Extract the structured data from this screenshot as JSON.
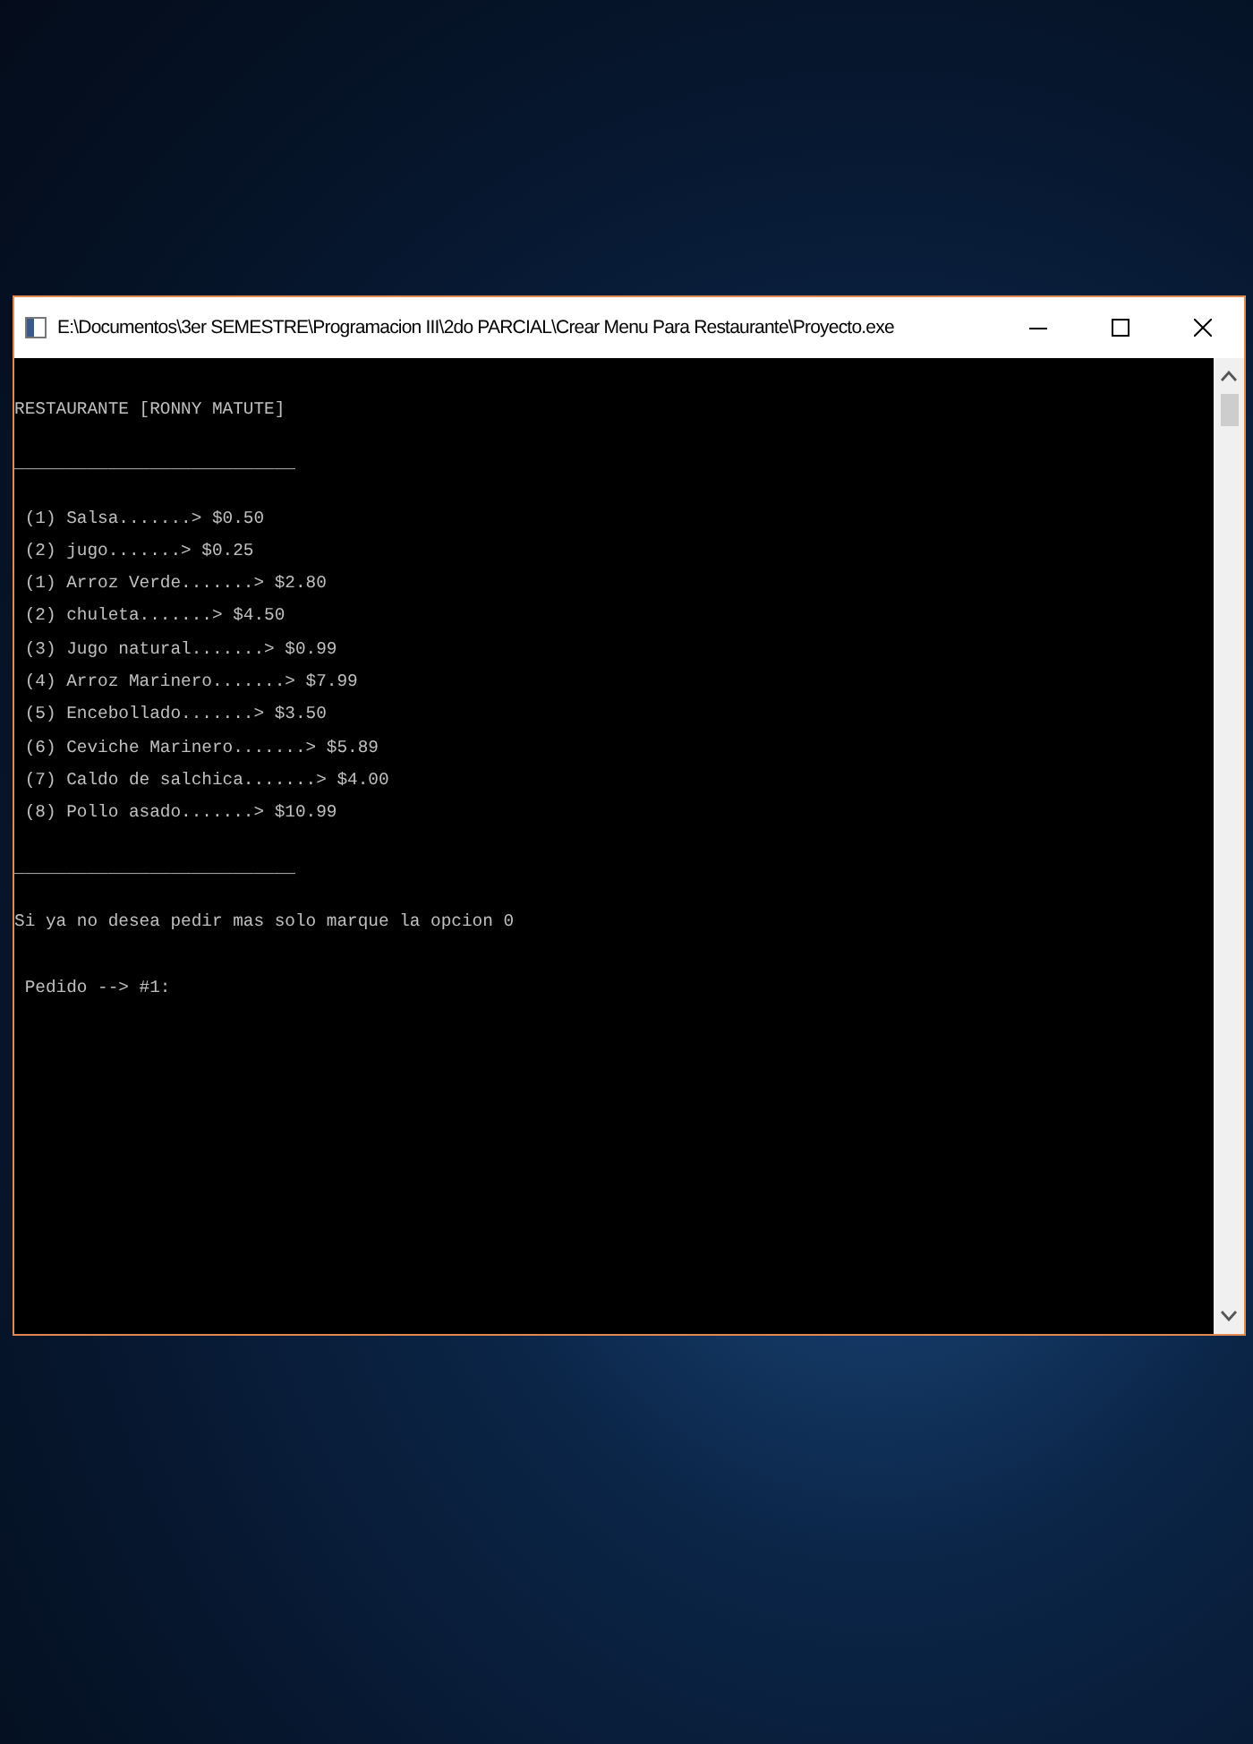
{
  "window": {
    "title": "E:\\Documentos\\3er SEMESTRE\\Programacion III\\2do PARCIAL\\Crear Menu Para Restaurante\\Proyecto.exe"
  },
  "console": {
    "header": "RESTAURANTE [RONNY MATUTE]",
    "separator_top": "___________________________",
    "menu_items": [
      " (1) Salsa.......> $0.50",
      " (2) jugo.......> $0.25",
      " (1) Arroz Verde.......> $2.80",
      " (2) chuleta.......> $4.50",
      " (3) Jugo natural.......> $0.99",
      " (4) Arroz Marinero.......> $7.99",
      " (5) Encebollado.......> $3.50",
      " (6) Ceviche Marinero.......> $5.89",
      " (7) Caldo de salchica.......> $4.00",
      " (8) Pollo asado.......> $10.99"
    ],
    "separator_bottom": "___________________________",
    "instruction": "Si ya no desea pedir mas solo marque la opcion 0",
    "prompt": " Pedido --> #1:"
  }
}
